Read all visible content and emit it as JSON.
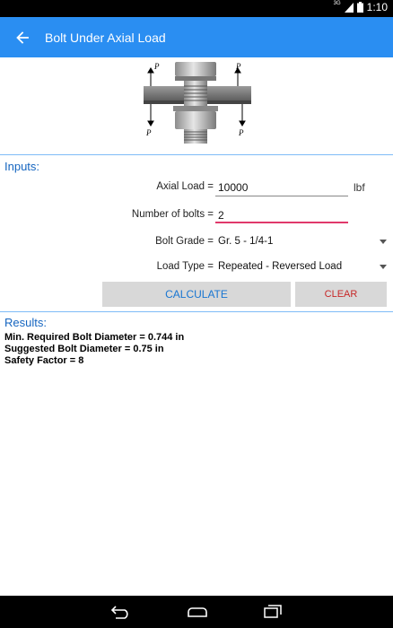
{
  "status_bar": {
    "network": "3G",
    "time": "1:10"
  },
  "app_bar": {
    "title": "Bolt Under Axial Load"
  },
  "figure": {
    "load_label": "P"
  },
  "inputs": {
    "title": "Inputs:",
    "axial_load": {
      "label": "Axial Load =",
      "value": "10000",
      "unit": "lbf"
    },
    "num_bolts": {
      "label": "Number of bolts =",
      "value": "2"
    },
    "bolt_grade": {
      "label": "Bolt Grade =",
      "value": "Gr. 5 - 1/4-1"
    },
    "load_type": {
      "label": "Load Type =",
      "value": "Repeated - Reversed Load"
    }
  },
  "buttons": {
    "calculate": "CALCULATE",
    "clear": "CLEAR"
  },
  "results": {
    "title": "Results:",
    "lines": [
      "Min. Required Bolt Diameter = 0.744 in",
      "Suggested Bolt Diameter = 0.75 in",
      "Safety Factor = 8"
    ]
  },
  "colors": {
    "accent": "#2a8ef2",
    "calc_text": "#1976d2",
    "clear_text": "#c62828",
    "active_underline": "#e0386b"
  }
}
